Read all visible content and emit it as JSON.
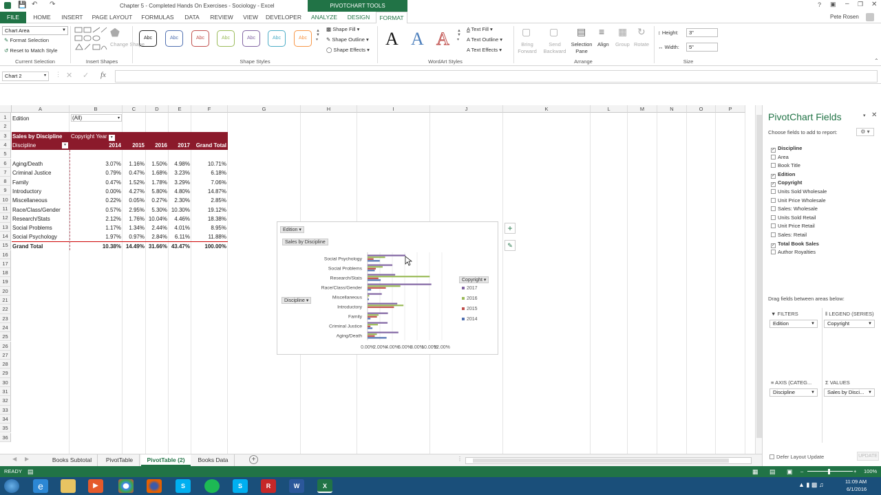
{
  "window": {
    "title": "Chapter 5 - Completed Hands On Exercises - Sociology - Excel",
    "context_tab": "PIVOTCHART TOOLS",
    "user": "Pete Rosen"
  },
  "tabs": [
    "FILE",
    "HOME",
    "INSERT",
    "PAGE LAYOUT",
    "FORMULAS",
    "DATA",
    "REVIEW",
    "VIEW",
    "DEVELOPER",
    "ANALYZE",
    "DESIGN",
    "FORMAT"
  ],
  "ribbon": {
    "chart_area": "Chart Area",
    "format_selection": "Format Selection",
    "reset_style": "Reset to Match Style",
    "current_selection": "Current Selection",
    "change_shape": "Change Shape",
    "insert_shapes": "Insert Shapes",
    "abc": "Abc",
    "shape_fill": "Shape Fill",
    "shape_outline": "Shape Outline",
    "shape_effects": "Shape Effects",
    "shape_styles": "Shape Styles",
    "text_fill": "Text Fill",
    "text_outline": "Text Outline",
    "text_effects": "Text Effects",
    "wordart_styles": "WordArt Styles",
    "wordart_letter": "A",
    "bring_forward": "Bring Forward",
    "send_backward": "Send Backward",
    "selection_pane": "Selection Pane",
    "align": "Align",
    "group": "Group",
    "rotate": "Rotate",
    "arrange": "Arrange",
    "height_label": "Height:",
    "height_value": "3\"",
    "width_label": "Width:",
    "width_value": "5\"",
    "size": "Size"
  },
  "formula_bar": {
    "name_box": "Chart 2",
    "fx": "fx",
    "value": ""
  },
  "columns": [
    "A",
    "B",
    "C",
    "D",
    "E",
    "F",
    "G",
    "H",
    "I",
    "J",
    "K",
    "L",
    "M",
    "N",
    "O",
    "P"
  ],
  "rows": [
    "1",
    "2",
    "3",
    "4",
    "5",
    "6",
    "7",
    "8",
    "9",
    "10",
    "11",
    "12",
    "13",
    "14",
    "15",
    "16",
    "17",
    "18",
    "19",
    "20",
    "21",
    "22",
    "23",
    "24",
    "25",
    "26",
    "27",
    "28",
    "29",
    "30",
    "31",
    "32",
    "33",
    "34",
    "35",
    "36"
  ],
  "sheet": {
    "filter_label": "Edition",
    "filter_value": "(All)",
    "pivot_title": "Sales by Discipline",
    "pivot_col_field": "Copyright Year",
    "row_field": "Discipline",
    "year_headers": [
      "2014",
      "2015",
      "2016",
      "2017",
      "Grand Total"
    ],
    "data_rows": [
      {
        "name": "Aging/Death",
        "vals": [
          "3.07%",
          "1.16%",
          "1.50%",
          "4.98%",
          "10.71%"
        ]
      },
      {
        "name": "Criminal Justice",
        "vals": [
          "0.79%",
          "0.47%",
          "1.68%",
          "3.23%",
          "6.18%"
        ]
      },
      {
        "name": "Family",
        "vals": [
          "0.47%",
          "1.52%",
          "1.78%",
          "3.29%",
          "7.06%"
        ]
      },
      {
        "name": "Introductory",
        "vals": [
          "0.00%",
          "4.27%",
          "5.80%",
          "4.80%",
          "14.87%"
        ]
      },
      {
        "name": "Miscellaneous",
        "vals": [
          "0.22%",
          "0.05%",
          "0.27%",
          "2.30%",
          "2.85%"
        ]
      },
      {
        "name": "Race/Class/Gender",
        "vals": [
          "0.57%",
          "2.95%",
          "5.30%",
          "10.30%",
          "19.12%"
        ]
      },
      {
        "name": "Research/Stats",
        "vals": [
          "2.12%",
          "1.76%",
          "10.04%",
          "4.46%",
          "18.38%"
        ]
      },
      {
        "name": "Social Problems",
        "vals": [
          "1.17%",
          "1.34%",
          "2.44%",
          "4.01%",
          "8.95%"
        ]
      },
      {
        "name": "Social Psychology",
        "vals": [
          "1.97%",
          "0.97%",
          "2.84%",
          "6.11%",
          "11.88%"
        ]
      }
    ],
    "grand_total": {
      "name": "Grand Total",
      "vals": [
        "10.38%",
        "14.49%",
        "31.66%",
        "43.47%",
        "100.00%"
      ]
    }
  },
  "chart_data": {
    "type": "bar",
    "categories": [
      "Aging/Death",
      "Criminal Justice",
      "Family",
      "Introductory",
      "Miscellaneous",
      "Race/Class/Gender",
      "Research/Stats",
      "Social Problems",
      "Social Psychology"
    ],
    "series": [
      {
        "name": "2014",
        "color": "#4f6fb0",
        "values": [
          3.07,
          0.79,
          0.47,
          0.0,
          0.22,
          0.57,
          2.12,
          1.17,
          1.97
        ]
      },
      {
        "name": "2015",
        "color": "#c0504d",
        "values": [
          1.16,
          0.47,
          1.52,
          4.27,
          0.05,
          2.95,
          1.76,
          1.34,
          0.97
        ]
      },
      {
        "name": "2016",
        "color": "#9bbb59",
        "values": [
          1.5,
          1.68,
          1.78,
          5.8,
          0.27,
          5.3,
          10.04,
          2.44,
          2.84
        ]
      },
      {
        "name": "2017",
        "color": "#8064a2",
        "values": [
          4.98,
          3.23,
          3.29,
          4.8,
          2.3,
          10.3,
          4.46,
          4.01,
          6.11
        ]
      }
    ],
    "xlim": [
      0,
      12
    ],
    "tick_labels": [
      "0.00%",
      "2.00%",
      "4.00%",
      "6.00%",
      "8.00%",
      "10.00%",
      "12.00%"
    ],
    "legend_position": "right",
    "field_buttons": {
      "filter": "Edition",
      "value": "Sales by Discipline",
      "axis": "Discipline",
      "legend": "Copyright"
    }
  },
  "pane": {
    "title": "PivotChart Fields",
    "subtitle": "Choose fields to add to report:",
    "fields": [
      {
        "name": "Discipline",
        "checked": true
      },
      {
        "name": "Area",
        "checked": false
      },
      {
        "name": "Book Title",
        "checked": false
      },
      {
        "name": "Edition",
        "checked": true
      },
      {
        "name": "Copyright",
        "checked": true
      },
      {
        "name": "Units Sold Wholesale",
        "checked": false
      },
      {
        "name": "Unit Price Wholesale",
        "checked": false
      },
      {
        "name": "Sales: Wholesale",
        "checked": false
      },
      {
        "name": "Units Sold Retail",
        "checked": false
      },
      {
        "name": "Unit Price Retail",
        "checked": false
      },
      {
        "name": "Sales: Retail",
        "checked": false
      },
      {
        "name": "Total Book Sales",
        "checked": true
      },
      {
        "name": "Author Royalties",
        "checked": false
      }
    ],
    "drag_label": "Drag fields between areas below:",
    "filters_label": "FILTERS",
    "filters_value": "Edition",
    "legend_label": "LEGEND (SERIES)",
    "legend_value": "Copyright",
    "axis_label": "AXIS (CATEG...",
    "axis_value": "Discipline",
    "values_label": "VALUES",
    "values_value": "Sales by Disci...",
    "defer_label": "Defer Layout Update",
    "update_label": "UPDATE"
  },
  "sheet_tabs": [
    "Books Subtotal",
    "PivotTable",
    "PivotTable (2)",
    "Books Data"
  ],
  "status": {
    "ready": "READY",
    "zoom": "100%"
  },
  "clock": {
    "time": "11:09 AM",
    "date": "6/1/2016"
  }
}
